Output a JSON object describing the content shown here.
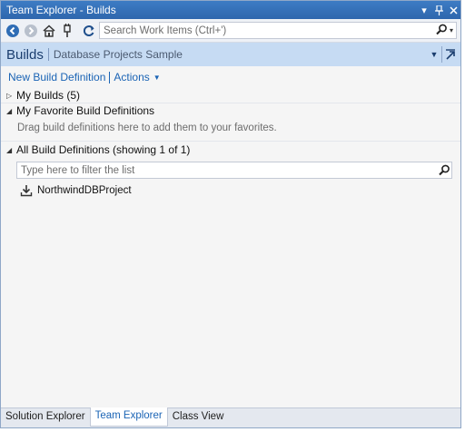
{
  "window": {
    "title": "Team Explorer - Builds",
    "title_buttons": [
      "▾",
      "⊥",
      "✕"
    ]
  },
  "toolbar": {
    "icons": [
      "back-icon",
      "forward-icon",
      "home-icon",
      "connect-icon",
      "refresh-icon"
    ],
    "search": {
      "placeholder": "Search Work Items (Ctrl+')",
      "search_glyph": "search-icon"
    }
  },
  "header": {
    "title": "Builds",
    "subtitle": "Database Projects Sample"
  },
  "links": {
    "new_build": "New Build Definition",
    "actions": "Actions"
  },
  "sections": {
    "my_builds": "My Builds (5)",
    "favorites": "My Favorite Build Definitions",
    "favorites_hint": "Drag build definitions here to add them to your favorites.",
    "all_defs": "All Build Definitions (showing 1 of 1)"
  },
  "filter": {
    "placeholder": "Type here to filter the list"
  },
  "definitions": [
    {
      "name": "NorthwindDBProject"
    }
  ],
  "tabs": [
    {
      "label": "Solution Explorer",
      "active": false
    },
    {
      "label": "Team Explorer",
      "active": true
    },
    {
      "label": "Class View",
      "active": false
    }
  ],
  "colors": {
    "title_bar": "#2e66ad",
    "header_bg": "#c6dbf3",
    "link": "#1b64b5"
  }
}
